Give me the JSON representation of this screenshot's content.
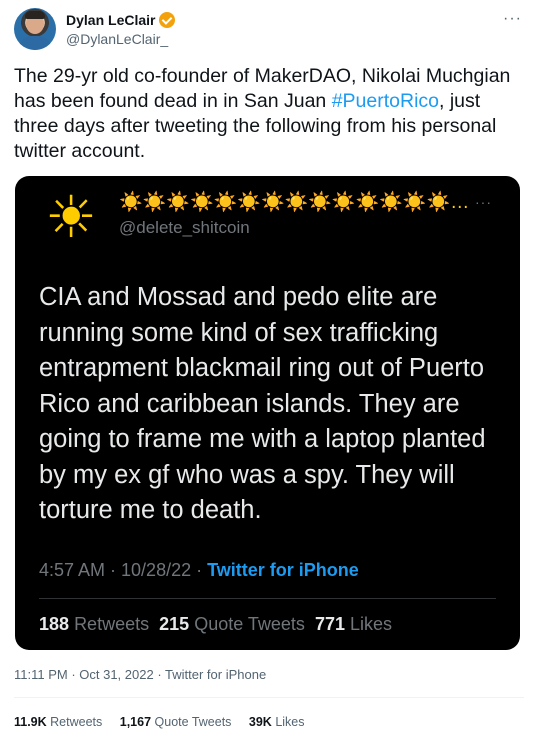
{
  "author": {
    "name": "Dylan LeClair",
    "handle": "@DylanLeClair_",
    "verified_color": "#f4a20c"
  },
  "tweet": {
    "text_before": "The 29-yr old co-founder of MakerDAO, Nikolai Muchgian has been found dead in in San Juan ",
    "hashtag": "#PuertoRico",
    "text_after": ", just three days after tweeting the following from his personal twitter account.",
    "more_icon": "···",
    "time": "11:11 PM · Oct 31, 2022 · Twitter for iPhone",
    "retweets": "11.9K",
    "retweets_label": "Retweets",
    "quote_tweets": "1,167",
    "quote_tweets_label": "Quote Tweets",
    "likes": "39K",
    "likes_label": "Likes"
  },
  "quoted": {
    "avatar_icon": "sun-emoji",
    "display_name": "☀️☀️☀️☀️☀️☀️☀️☀️☀️☀️☀️☀️☀️☀️…",
    "handle": "@delete_shitcoin",
    "more_icon": "···",
    "text": "CIA and Mossad and pedo elite are running some kind of sex trafficking entrapment blackmail ring out of Puerto Rico and caribbean islands. They are going to frame me with a laptop planted by my ex gf who was a spy. They will torture me to death.",
    "time": "4:57 AM · 10/28/22 · ",
    "source": "Twitter for iPhone",
    "retweets": "188",
    "retweets_label": "Retweets",
    "quote_tweets": "215",
    "quote_tweets_label": "Quote Tweets",
    "likes": "771",
    "likes_label": "Likes"
  }
}
